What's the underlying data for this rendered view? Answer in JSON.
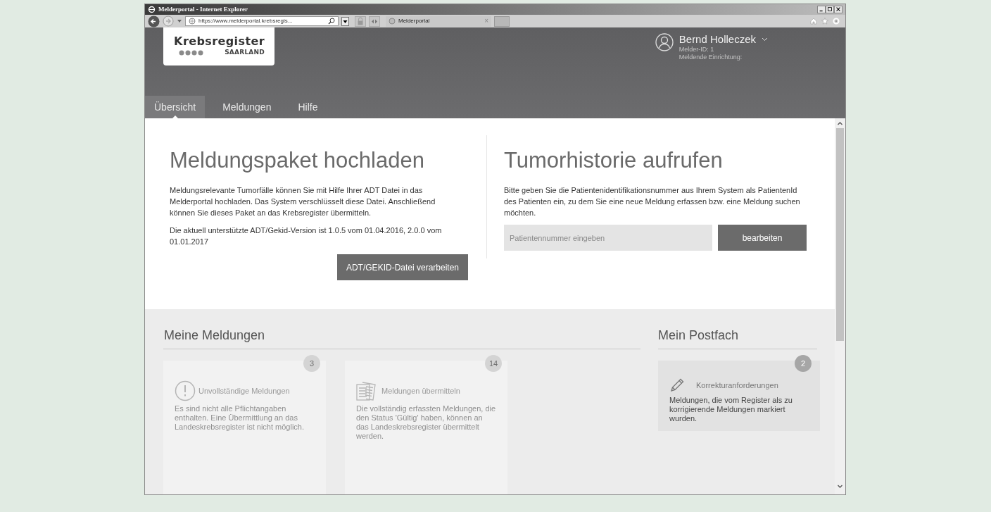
{
  "browser": {
    "title": "Melderportal - Internet Explorer",
    "url": "https://www.melderportal.krebsregis...",
    "tabs": [
      {
        "label": "Melderportal",
        "selected": true,
        "close": "×"
      }
    ]
  },
  "header": {
    "logo": {
      "name": "Krebsregister",
      "region": "SAARLAND"
    },
    "user": {
      "name": "Bernd Holleczek",
      "melder_id": "Melder-ID: 1",
      "institution": "Meldende Einrichtung:"
    }
  },
  "nav": [
    {
      "label": "Übersicht",
      "selected": true
    },
    {
      "label": "Meldungen",
      "selected": false
    },
    {
      "label": "Hilfe",
      "selected": false
    }
  ],
  "upload": {
    "title": "Meldungspaket hochladen",
    "paragraphs": [
      "Meldungsrelevante Tumorfälle können Sie mit Hilfe Ihrer ADT Datei in das Melderportal hochladen. Das System verschlüsselt diese Datei. Anschließend können Sie dieses Paket an das Krebsregister übermitteln.",
      "Die aktuell unterstützte ADT/Gekid-Version ist 1.0.5 vom 01.04.2016, 2.0.0 vom 01.01.2017"
    ],
    "button": "ADT/GEKID-Datei verarbeiten"
  },
  "history": {
    "title": "Tumorhistorie aufrufen",
    "text": "Bitte geben Sie die Patientenidentifikationsnummer aus Ihrem System als PatientenId des Patienten ein, zu dem Sie eine neue Meldung erfassen bzw. eine Meldung suchen möchten.",
    "placeholder": "Patientennummer eingeben",
    "button": "bearbeiten"
  },
  "my_reports": {
    "title": "Meine Meldungen",
    "cards": [
      {
        "kind": "warning",
        "count": "3",
        "title": "Unvollständige Meldungen",
        "text": "Es sind nicht alle Pflichtangaben enthalten. Eine Übermittlung an das Landeskrebsregister ist nicht möglich.",
        "disabled": true
      },
      {
        "kind": "documents",
        "count": "14",
        "title": "Meldungen übermitteln",
        "text": "Die vollständig erfassten Meldungen, die den Status 'Gültig' haben, können an das Landeskrebsregister übermittelt werden.",
        "disabled": true
      }
    ]
  },
  "mailbox": {
    "title": "Mein Postfach",
    "cards": [
      {
        "kind": "pencil",
        "count": "2",
        "title": "Korrekturanforderungen",
        "text": "Meldungen, die vom Register als zu korrigierende Meldungen markiert wurden.",
        "disabled": false
      }
    ]
  }
}
